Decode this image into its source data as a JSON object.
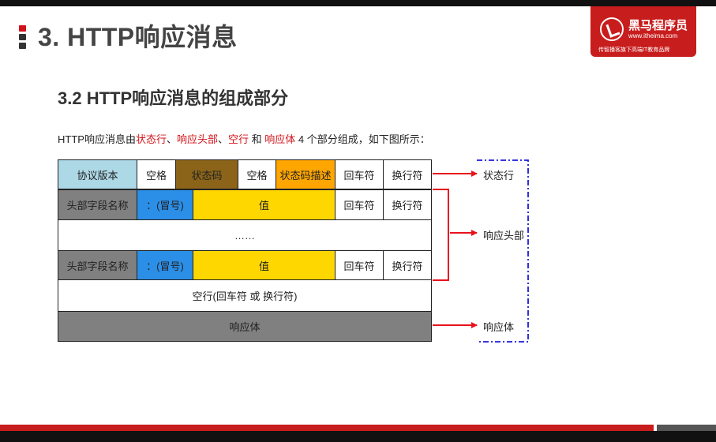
{
  "header": {
    "title": "3. HTTP响应消息",
    "logo": {
      "brand": "黑马程序员",
      "url": "www.itheima.com",
      "slogan": "传智播客旗下高端IT教育品牌"
    }
  },
  "section_title": "3.2 HTTP响应消息的组成部分",
  "description": {
    "prefix": "HTTP响应消息由",
    "part1": "状态行",
    "sep1": "、",
    "part2": "响应头部",
    "sep2": "、",
    "part3": "空行",
    "mid": " 和 ",
    "part4": "响应体",
    "suffix": " 4 个部分组成，如下图所示："
  },
  "diagram": {
    "status_line": [
      "协议版本",
      "空格",
      "状态码",
      "空格",
      "状态码描述",
      "回车符",
      "换行符"
    ],
    "header_row1": [
      "头部字段名称",
      "：(冒号)",
      "值",
      "回车符",
      "换行符"
    ],
    "ellipsis": "……",
    "header_row2": [
      "头部字段名称",
      "：(冒号)",
      "值",
      "回车符",
      "换行符"
    ],
    "blank_line": "空行(回车符 或 换行符)",
    "body": "响应体",
    "labels": {
      "status_line": "状态行",
      "headers": "响应头部",
      "body": "响应体"
    },
    "colors": {
      "protocol": "#add8e6",
      "status_code": "#8b6419",
      "status_desc": "#ffa500",
      "field_name": "#808080",
      "colon": "#2b8fe8",
      "value": "#ffd700",
      "body": "#808080",
      "arrow": "#e8121b",
      "bracket": "#1a1adc"
    }
  }
}
